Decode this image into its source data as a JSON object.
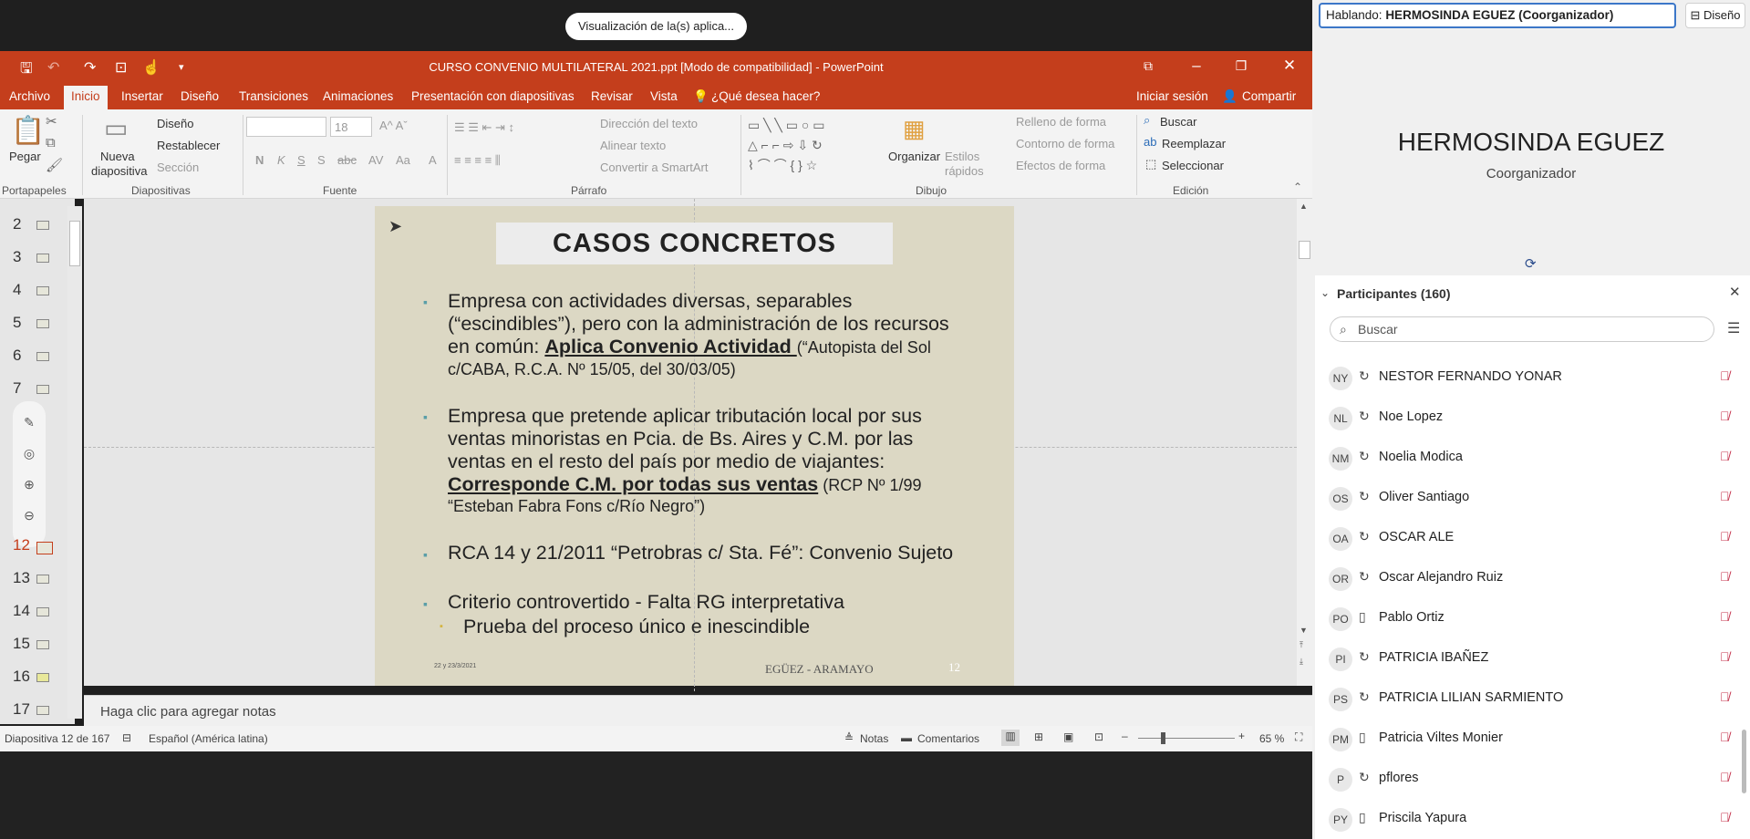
{
  "meeting": {
    "share_pill": "Visualización de la(s) aplica..."
  },
  "app": {
    "title": "CURSO CONVENIO MULTILATERAL 2021.ppt [Modo de compatibilidad] - PowerPoint"
  },
  "menu": {
    "items": [
      "Archivo",
      "Inicio",
      "Insertar",
      "Diseño",
      "Transiciones",
      "Animaciones",
      "Presentación con diapositivas",
      "Revisar",
      "Vista"
    ],
    "tell_me": "¿Qué desea hacer?",
    "sign_in": "Iniciar sesión",
    "share": "Compartir"
  },
  "ribbon": {
    "clipboard": {
      "paste": "Pegar",
      "label": "Portapapeles"
    },
    "slides": {
      "new_line1": "Nueva",
      "new_line2": "diapositiva",
      "layout": "Diseño",
      "reset": "Restablecer",
      "section": "Sección",
      "label": "Diapositivas"
    },
    "font": {
      "size": "18",
      "label": "Fuente"
    },
    "paragraph": {
      "text_dir": "Dirección del texto",
      "align": "Alinear texto",
      "smartart": "Convertir a SmartArt",
      "label": "Párrafo"
    },
    "drawing": {
      "arrange": "Organizar",
      "styles_line1": "Estilos",
      "styles_line2": "rápidos",
      "fill": "Relleno de forma",
      "outline": "Contorno de forma",
      "effects": "Efectos de forma",
      "label": "Dibujo"
    },
    "editing": {
      "find": "Buscar",
      "replace": "Reemplazar",
      "select": "Seleccionar",
      "label": "Edición"
    }
  },
  "thumbnails": {
    "numbers": [
      "2",
      "3",
      "4",
      "5",
      "6",
      "7",
      "12",
      "13",
      "14",
      "15",
      "16",
      "17"
    ],
    "current": "12"
  },
  "slide": {
    "title": "CASOS CONCRETOS",
    "b1_l1": "Empresa con actividades diversas, separables",
    "b1_l2": "(“escindibles”), pero con la administración de los recursos",
    "b1_l3a": "en común: ",
    "b1_l3b": "Aplica Convenio Actividad ",
    "b1_l3c": "(“Autopista del Sol",
    "b1_l4": "c/CABA, R.C.A. Nº 15/05, del 30/03/05)",
    "b2_l1": "Empresa que pretende aplicar tributación local por sus",
    "b2_l2": "ventas minoristas en Pcia. de Bs. Aires y C.M. por las",
    "b2_l3": "ventas en el resto del país por medio de viajantes:",
    "b2_l4a": "Corresponde C.M. por todas sus ventas",
    "b2_l4b": " (RCP Nº 1/99",
    "b2_l5": "“Esteban Fabra Fons c/Río Negro”)",
    "b3": "RCA 14 y 21/2011 “Petrobras c/ Sta. Fé”: Convenio Sujeto",
    "b4": "Criterio controvertido  - Falta RG interpretativa",
    "b5": "Prueba del proceso único e inescindible",
    "footer_date": "22 y 23/3/2021",
    "footer_authors": "EGÜEZ - ARAMAYO",
    "footer_num": "12"
  },
  "notes": {
    "placeholder": "Haga clic para agregar notas"
  },
  "status": {
    "slide": "Diapositiva 12 de 167",
    "lang": "Español (América latina)",
    "notes": "Notas",
    "comments": "Comentarios",
    "zoom": "65 %"
  },
  "speaker": {
    "prefix": "Hablando: ",
    "name_box": "HERMOSINDA EGUEZ (Coorganizador)",
    "layout": "Diseño",
    "name": "HERMOSINDA EGUEZ",
    "role": "Coorganizador"
  },
  "participants": {
    "header": "Participantes (160)",
    "search_placeholder": "Buscar",
    "list": [
      {
        "initials": "NY",
        "name": "NESTOR FERNANDO YONAR",
        "device": "↻"
      },
      {
        "initials": "NL",
        "name": "Noe Lopez",
        "device": "↻"
      },
      {
        "initials": "NM",
        "name": "Noelia Modica",
        "device": "↻"
      },
      {
        "initials": "OS",
        "name": "Oliver Santiago",
        "device": "↻"
      },
      {
        "initials": "OA",
        "name": "OSCAR ALE",
        "device": "↻"
      },
      {
        "initials": "OR",
        "name": "Oscar Alejandro Ruiz",
        "device": "↻"
      },
      {
        "initials": "PO",
        "name": "Pablo Ortiz",
        "device": "▯"
      },
      {
        "initials": "PI",
        "name": "PATRICIA IBAÑEZ",
        "device": "↻"
      },
      {
        "initials": "PS",
        "name": "PATRICIA LILIAN SARMIENTO",
        "device": "↻"
      },
      {
        "initials": "PM",
        "name": "Patricia Viltes Monier",
        "device": "▯"
      },
      {
        "initials": "P",
        "name": "pflores",
        "device": "↻"
      },
      {
        "initials": "PY",
        "name": "Priscila Yapura",
        "device": "▯"
      }
    ]
  }
}
